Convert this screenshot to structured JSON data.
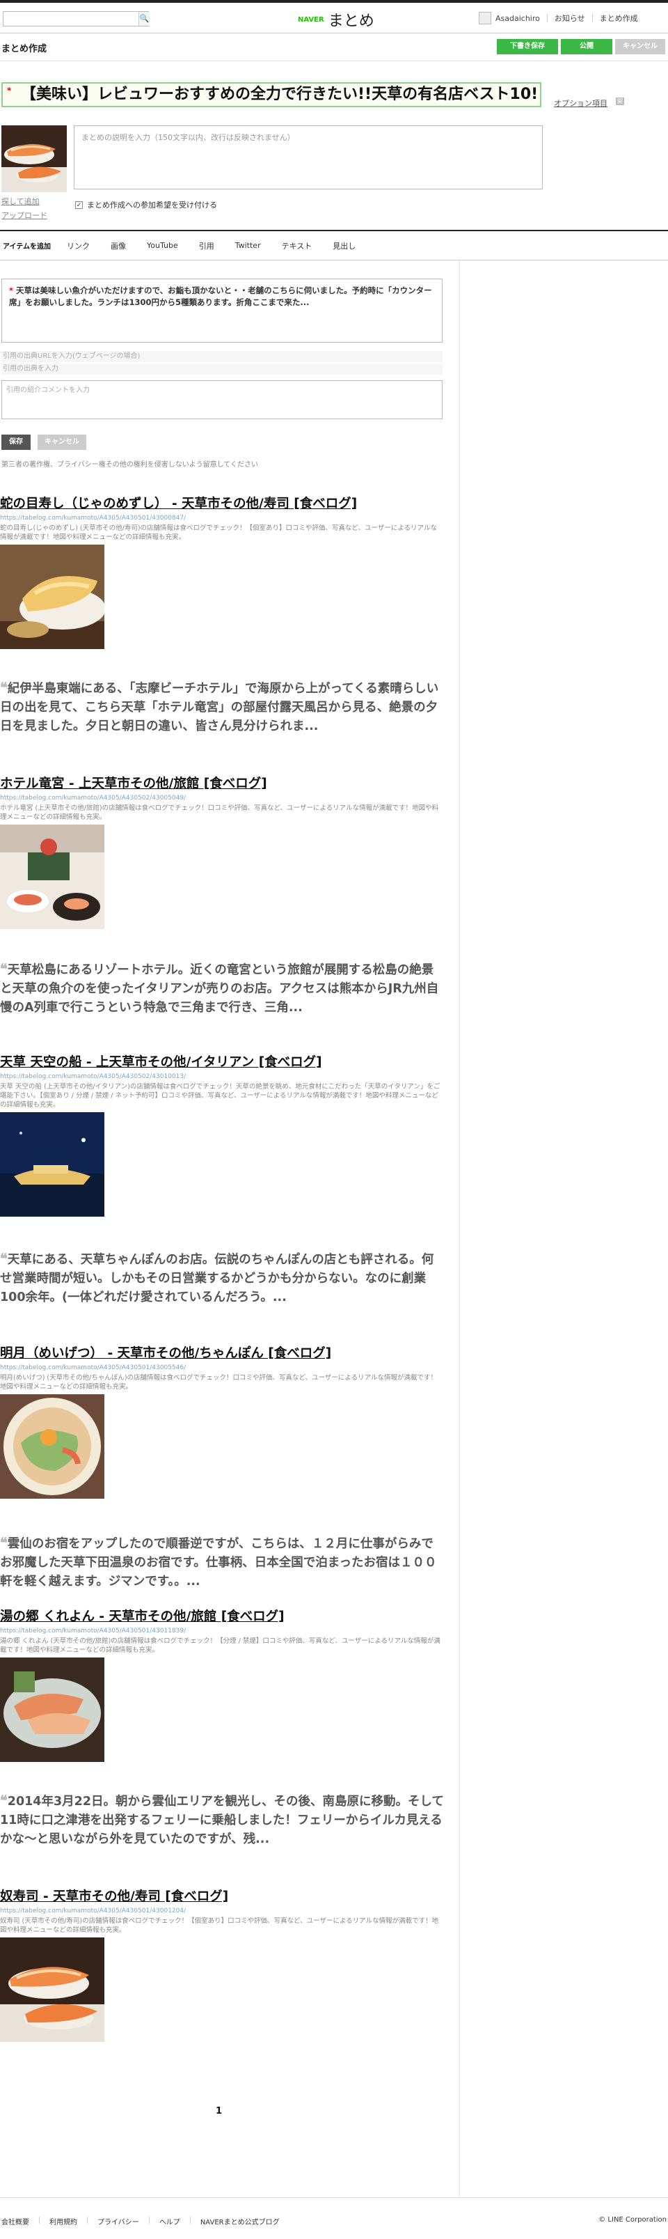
{
  "header": {
    "search_placeholder": "",
    "search_button": "🔍",
    "logo_naver": "NAVER",
    "logo_matome": "まとめ",
    "user_name": "Asadaichiro",
    "nav": [
      "お知らせ",
      "まとめ作成"
    ]
  },
  "toolbar": {
    "page_title": "まとめ作成",
    "save_draft": "下書き保存",
    "publish": "公開",
    "cancel": "キャンセル"
  },
  "editor_header": {
    "title_required": "*",
    "title": "【美味い】レビュワーおすすめの全力で行きたい!!天草の有名店ベスト10!",
    "option_link": "オプション項目",
    "option_icon": "開",
    "thumb_link": "探して追加\nアップロード",
    "desc_placeholder": "まとめの説明を入力（150文字以内、改行は反映されません）",
    "collab_label": "まとめ作成への参加希望を受け付ける"
  },
  "item_tabs": {
    "label": "アイテムを追加",
    "tabs": [
      "リンク",
      "画像",
      "YouTube",
      "引用",
      "Twitter",
      "テキスト",
      "見出し"
    ]
  },
  "quote_editor": {
    "required_mark": "*",
    "text": "天草は美味しい魚介がいただけますので、お鮨も頂かないと・・老舗のこちらに伺いました。予約時に「カウンター席」をお願いしました。ランチは1300円から5種類あります。折角ここまで来た...",
    "source_url_placeholder": "引用の出典URLを入力(ウェブページの場合)",
    "source_placeholder": "引用の出典を入力",
    "comment_placeholder": "引用の紹介コメントを入力",
    "save": "保存",
    "cancel": "キャンセル",
    "notice": "第三者の著作権、プライバシー権その他の権利を侵害しないよう留意してください"
  },
  "items": [
    {
      "title": "蛇の目寿し（じゃのめずし） - 天草市その他/寿司 [食べログ]",
      "url": "https://tabelog.com/kumamoto/A4305/A430501/43000847/",
      "desc": "蛇の目寿し(じゃのめずし) (天草市その他/寿司)の店舗情報は食べログでチェック！【個室あり】口コミや評価、写真など、ユーザーによるリアルな情報が満載です！地図や料理メニューなどの詳細情報も充実。",
      "image": "sushi-egg"
    },
    {
      "quote": "紀伊半島東端にある、「志摩ビーチホテル」で海原から上がってくる素晴らしい日の出を見て、こちら天草「ホテル竜宮」の部屋付露天風呂から見る、絶景の夕日を見ました。夕日と朝日の違い、皆さん見分けられま..."
    },
    {
      "title": "ホテル竜宮 - 上天草市その他/旅館 [食べログ]",
      "url": "https://tabelog.com/kumamoto/A4305/A430502/43005049/",
      "desc": "ホテル竜宮 (上天草市その他/旅館)の店舗情報は食べログでチェック！口コミや評価、写真など、ユーザーによるリアルな情報が満載です！地図や料理メニューなどの詳細情報も充実。",
      "image": "kaiseki"
    },
    {
      "quote": "天草松島にあるリゾートホテル。近くの竜宮という旅館が展開する松島の絶景と天草の魚介のを使ったイタリアンが売りのお店。アクセスは熊本からJR九州自慢のA列車で行こうという特急で三角まで行き、三角..."
    },
    {
      "title": "天草 天空の船 - 上天草市その他/イタリアン [食べログ]",
      "url": "https://tabelog.com/kumamoto/A4305/A430502/43010013/",
      "desc": "天草 天空の船 (上天草市その他/イタリアン)の店舗情報は食べログでチェック！天草の絶景を眺め、地元食材にこだわった「天草のイタリアン」をご堪能下さい。【個室あり / 分煙 / 禁煙 / ネット予約可】口コミや評価、写真など、ユーザーによるリアルな情報が満載です！地図や料理メニューなどの詳細情報も充実。",
      "image": "night-ship"
    },
    {
      "quote": "天草にある、天草ちゃんぽんのお店。伝説のちゃんぽんの店とも評される。何せ営業時間が短い。しかもその日営業するかどうかも分からない。なのに創業100余年。(一体どれだけ愛されているんだろう。..."
    },
    {
      "title": "明月（めいげつ） - 天草市その他/ちゃんぽん [食べログ]",
      "url": "https://tabelog.com/kumamoto/A4305/A430501/43005546/",
      "desc": "明月(めいげつ) (天草市その他/ちゃんぽん)の店舗情報は食べログでチェック！口コミや評価、写真など、ユーザーによるリアルな情報が満載です！地図や料理メニューなどの詳細情報も充実。",
      "image": "champon"
    },
    {
      "quote": "雲仙のお宿をアップしたので順番逆ですが、こちらは、１２月に仕事がらみでお邪魔した天草下田温泉のお宿です。仕事柄、日本全国で泊まったお宿は１００軒を軽く越えます。ジマンです。。..."
    },
    {
      "title": "湯の郷 くれよん - 天草市その他/旅館 [食べログ]",
      "url": "https://tabelog.com/kumamoto/A4305/A430501/43011839/",
      "desc": "湯の郷 くれよん (天草市その他/旅館)の店舗情報は食べログでチェック！【分煙 / 禁煙】口コミや評価、写真など、ユーザーによるリアルな情報が満載です！地図や料理メニューなどの詳細情報も充実。",
      "image": "sashimi"
    },
    {
      "quote": "2014年3月22日。朝から雲仙エリアを観光し、その後、南島原に移動。そして11時に口之津港を出発するフェリーに乗船しました！フェリーからイルカ見えるかな〜と思いながら外を見ていたのですが、残..."
    },
    {
      "title": "奴寿司 - 天草市その他/寿司 [食べログ]",
      "url": "https://tabelog.com/kumamoto/A4305/A430501/43001204/",
      "desc": "奴寿司 (天草市その他/寿司)の店舗情報は食べログでチェック！【個室あり】口コミや評価、写真など、ユーザーによるリアルな情報が満載です！地図や料理メニューなどの詳細情報も充実。",
      "image": "shrimp-sushi"
    }
  ],
  "pager": {
    "current": "1"
  },
  "footer": {
    "links": [
      "会社概要",
      "利用規約",
      "プライバシー",
      "ヘルプ",
      "NAVERまとめ公式ブログ"
    ],
    "copyright": "© LINE Corporation"
  }
}
